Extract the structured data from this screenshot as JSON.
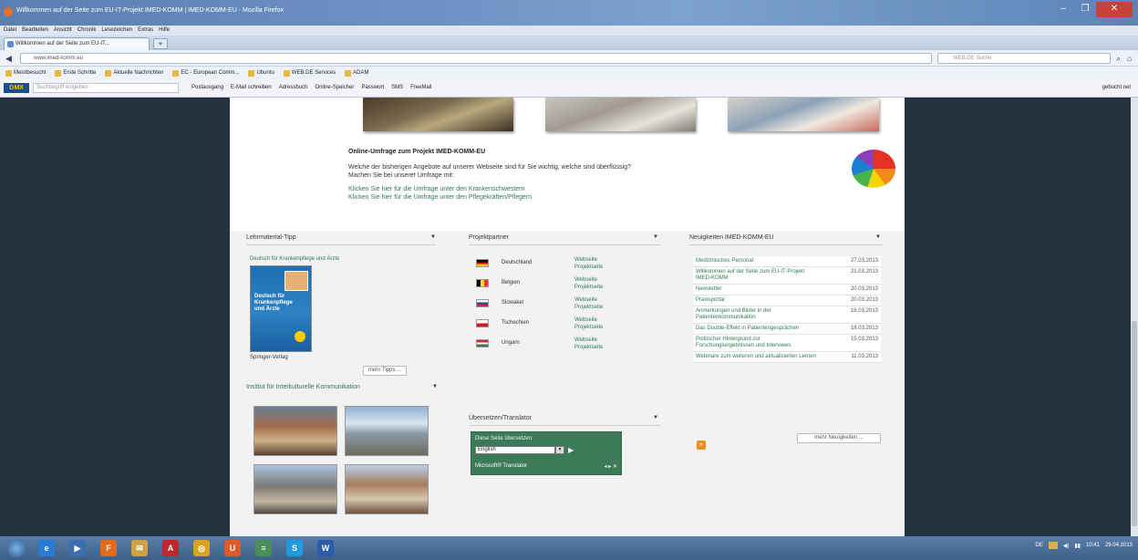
{
  "browser": {
    "window_title": "Willkommen auf der Seite zum EU-IT-Projekt IMED-KOMM | IMED-KOMM-EU - Mozilla Firefox",
    "menu": [
      "Datei",
      "Bearbeiten",
      "Ansicht",
      "Chronik",
      "Lesezeichen",
      "Extras",
      "Hilfe"
    ],
    "tab_label": "Willkommen auf der Seite zum EU-IT...",
    "new_tab": "+",
    "url": "www.imed-komm.eu",
    "search_placeholder": "WEB.DE Suche",
    "bookmarks": [
      "Meistbesucht",
      "Erste Schritte",
      "Aktuelle Nachrichten",
      "EC - European Comm...",
      "Ubuntu",
      "WEB.DE Services",
      "ADAM"
    ],
    "addon_logo": "GMX",
    "addon_search_placeholder": "Suchbegriff eingeben",
    "addon_tools": [
      "Postausgang",
      "E-Mail schreiben",
      "Adressbuch",
      "Online-Speicher",
      "Passwort",
      "SMS",
      "FreeMail"
    ],
    "addon_right": "gebucht.net"
  },
  "page": {
    "survey": {
      "title": "Online-Umfrage zum Projekt IMED-KOMM-EU",
      "text1": "Welche der bisherigen Angebote auf unserer Webseite sind für Sie wichtig, welche sind überflüssig?",
      "text2": "Machen Sie bei unserer Umfrage mit:",
      "link1": "Klicken Sie hier für die Umfrage unter den Krankenschwestern",
      "link2": "Klicken Sie hier für die Umfrage unter den Pflegekräften/Pflegern"
    },
    "col1": {
      "head": "Lehrmaterial-Tipp",
      "book_title": "Deutsch für Krankenpflege und Ärzte",
      "cover_title": "Deutsch für Krankenpflege und Ärzte",
      "publisher": "Springer-Verlag",
      "more": "mehr Tipps ...",
      "iik_head": "Institut für Interkulturelle Kommunikation"
    },
    "col2": {
      "head": "Projektpartner",
      "partners": [
        {
          "country": "Deutschland",
          "l1": "Webseite",
          "l2": "Projektseite",
          "flag": "#d4a017"
        },
        {
          "country": "Belgien",
          "l1": "Webseite",
          "l2": "Projektseite",
          "flag": "#e1c21a"
        },
        {
          "country": "Slowakei",
          "l1": "Webseite",
          "l2": "Projektseite",
          "flag": "#2c4fb4"
        },
        {
          "country": "Tschechien",
          "l1": "Webseite",
          "l2": "Projektseite",
          "flag": "#c52b2b"
        },
        {
          "country": "Ungarn",
          "l1": "Webseite",
          "l2": "Projektseite",
          "flag": "#3f8f4a"
        }
      ],
      "translator_head": "Übersetzen/Translator",
      "translator_label": "Diese Seite übersetzen:",
      "translator_lang": "English",
      "translator_brand": "Microsoft® Translator",
      "translator_right": "◂ ▸  ✕"
    },
    "col3": {
      "head": "Neuigkeiten IMED-KOMM-EU",
      "news": [
        {
          "title": "Medizinisches Personal",
          "date": "27.03.2013"
        },
        {
          "title": "Willkommen auf der Seite zum EU-IT-Projekt IMED-KOMM",
          "date": "21.03.2013"
        },
        {
          "title": "Newsletter",
          "date": "20.03.2013"
        },
        {
          "title": "Praxisportal",
          "date": "20.03.2013"
        },
        {
          "title": "Anmerkungen und Bilder in der Patientenkommunikation",
          "date": "18.03.2013"
        },
        {
          "title": "Das Double-Effekt in Patientengesprächen",
          "date": "18.03.2013"
        },
        {
          "title": "Politischer Hintergrund zur Forschungsergebnissen und Interviews",
          "date": "15.03.2013"
        },
        {
          "title": "Webinare zum weiteren und aktualisierten Lernen",
          "date": "11.03.2013"
        }
      ],
      "rss": "»",
      "more": "mehr Neuigkeiten ..."
    }
  },
  "taskbar": {
    "apps": [
      {
        "name": "explorer",
        "label": "e",
        "color": "#2a7bd4"
      },
      {
        "name": "media",
        "label": "▶",
        "color": "#3a6fb0"
      },
      {
        "name": "firefox",
        "label": "F",
        "color": "#e26a1c"
      },
      {
        "name": "mail",
        "label": "✉",
        "color": "#cfa24a"
      },
      {
        "name": "acrobat",
        "label": "A",
        "color": "#c0262d"
      },
      {
        "name": "chrome",
        "label": "◎",
        "color": "#d9a425"
      },
      {
        "name": "ubuntu",
        "label": "U",
        "color": "#de5a2a"
      },
      {
        "name": "notes",
        "label": "≡",
        "color": "#4a8f5a"
      },
      {
        "name": "skype",
        "label": "S",
        "color": "#1e9ae0"
      },
      {
        "name": "word",
        "label": "W",
        "color": "#2b5caa"
      }
    ],
    "tray_lang": "DE",
    "clock_time": "10:41",
    "clock_date": "29.04.2013"
  }
}
